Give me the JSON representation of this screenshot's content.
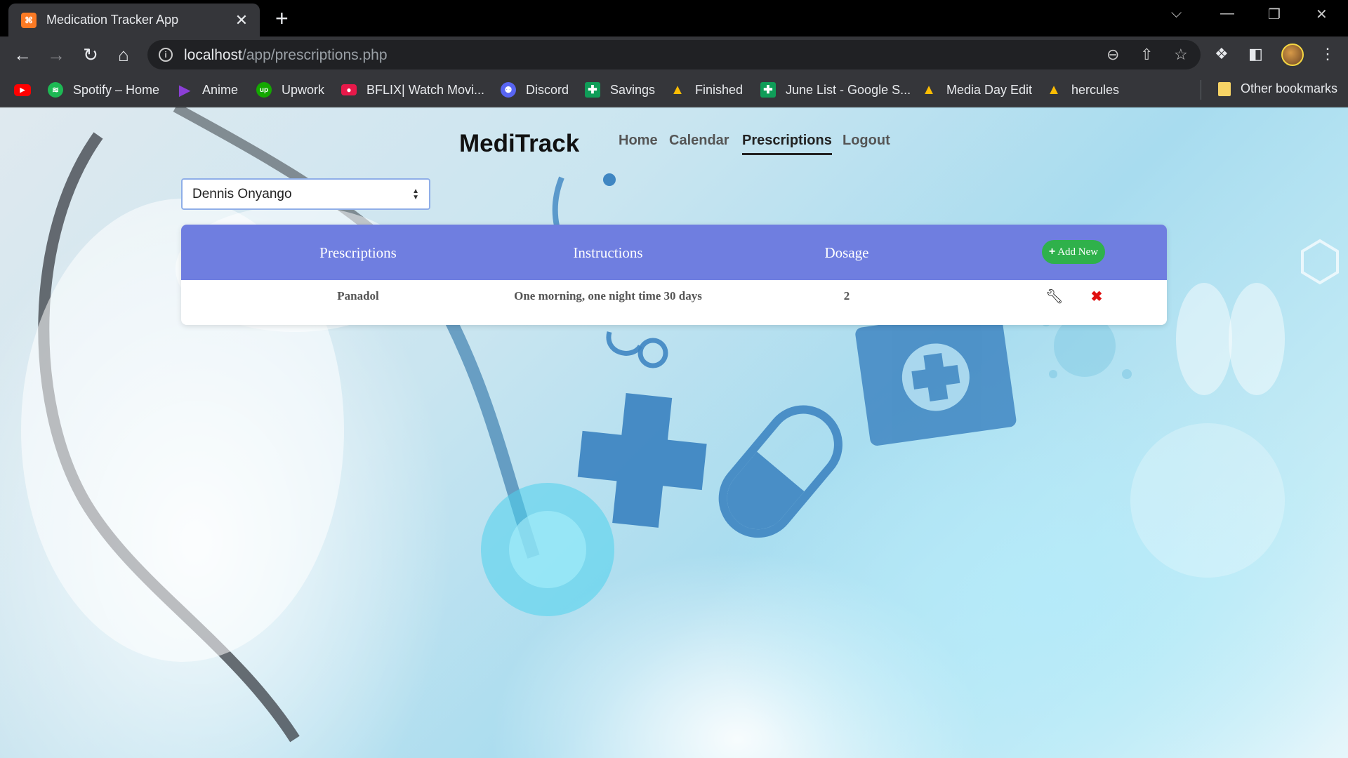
{
  "browser": {
    "tab_title": "Medication Tracker App",
    "tab_favicon": "xampp-icon",
    "url_host": "localhost",
    "url_path": "/app/prescriptions.php",
    "bookmarks": [
      {
        "label": "",
        "icon": "youtube-icon",
        "color": "#ff0000"
      },
      {
        "label": "Spotify – Home",
        "icon": "spotify-icon",
        "color": "#1db954"
      },
      {
        "label": "Anime",
        "icon": "play-icon",
        "color": "#8b3fd6"
      },
      {
        "label": "Upwork",
        "icon": "upwork-icon",
        "color": "#14a800"
      },
      {
        "label": "BFLIX| Watch Movi...",
        "icon": "bflix-icon",
        "color": "#e8194a"
      },
      {
        "label": "Discord",
        "icon": "discord-icon",
        "color": "#5865f2"
      },
      {
        "label": "Savings",
        "icon": "sheets-icon",
        "color": "#0f9d58"
      },
      {
        "label": "Finished",
        "icon": "drive-icon",
        "color": "#fbbc04"
      },
      {
        "label": "June List - Google S...",
        "icon": "sheets-icon",
        "color": "#0f9d58"
      },
      {
        "label": "Media Day Edit",
        "icon": "drive-icon",
        "color": "#fbbc04"
      },
      {
        "label": "hercules",
        "icon": "drive-icon",
        "color": "#fbbc04"
      }
    ],
    "other_bookmarks": "Other bookmarks"
  },
  "header": {
    "brand": "MediTrack",
    "nav": [
      "Home",
      "Calendar",
      "Prescriptions",
      "Logout"
    ],
    "active_nav": "Prescriptions"
  },
  "patient_select": {
    "selected": "Dennis Onyango"
  },
  "table": {
    "columns": [
      "Prescriptions",
      "Instructions",
      "Dosage"
    ],
    "add_button": "Add New",
    "rows": [
      {
        "prescription": "Panadol",
        "instructions": "One morning, one night time 30 days",
        "dosage": "2"
      }
    ]
  },
  "colors": {
    "table_header": "#6f7ee0",
    "add_button": "#2fb14b",
    "delete": "#e01010"
  }
}
